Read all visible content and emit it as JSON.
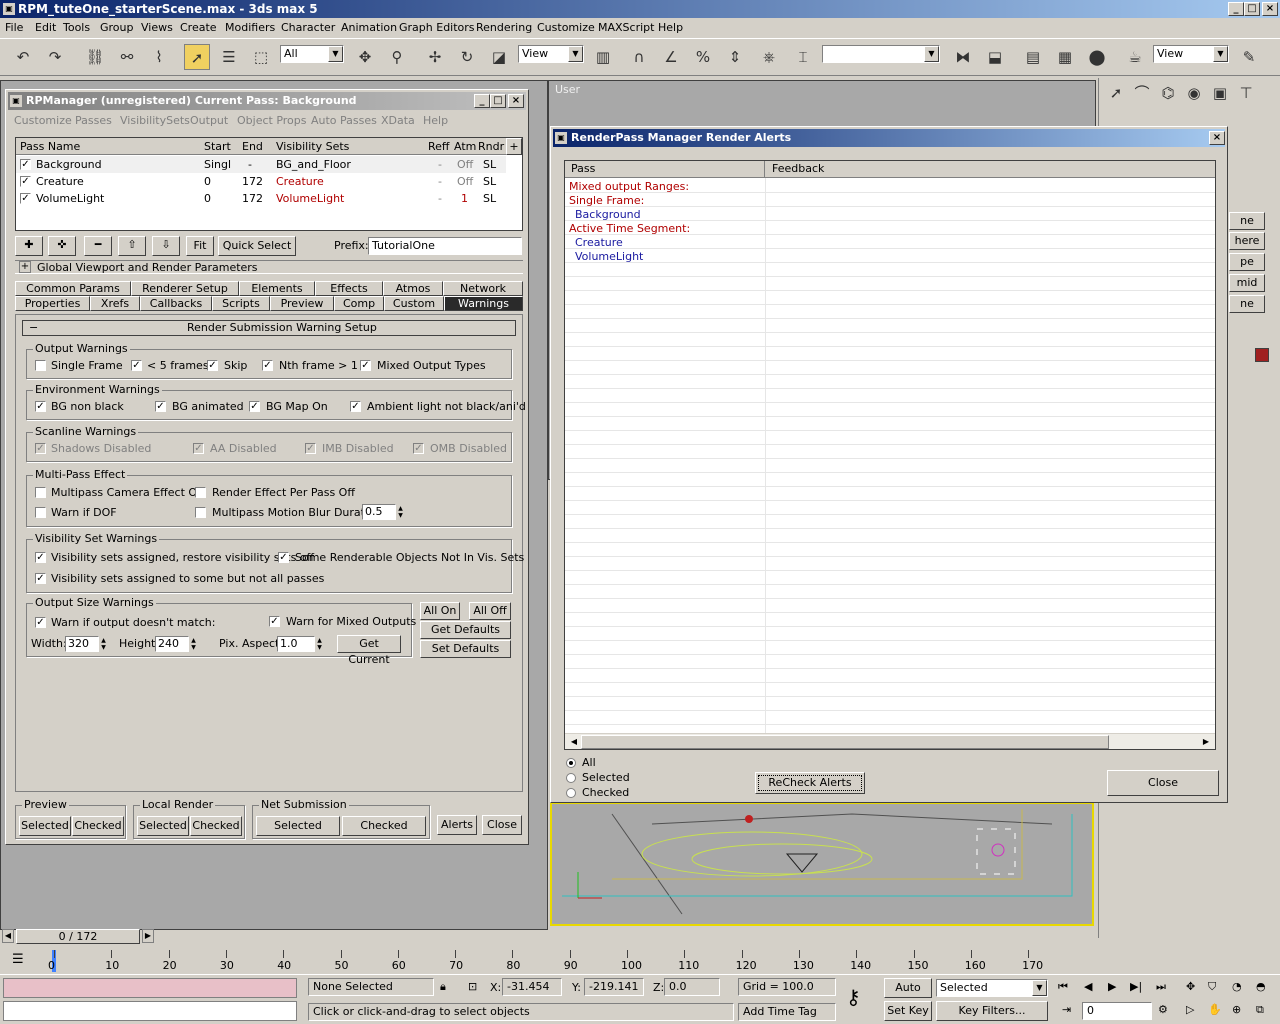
{
  "app": {
    "title": "RPM_tuteOne_starterScene.max - 3ds max 5"
  },
  "menu": [
    "File",
    "Edit",
    "Tools",
    "Group",
    "Views",
    "Create",
    "Modifiers",
    "Character",
    "Animation",
    "Graph Editors",
    "Rendering",
    "Customize",
    "MAXScript",
    "Help"
  ],
  "toolbar": {
    "selection_filter": "All",
    "ref_coord": "View",
    "named_sel": "",
    "render_type": "View"
  },
  "viewport": {
    "label": "User"
  },
  "rpm": {
    "title": "RPManager (unregistered)  Current Pass: Background",
    "menu": [
      "Customize",
      "Passes",
      "VisibilitySets",
      "Output",
      "Object Props",
      "Auto Passes",
      "XData",
      "Help"
    ],
    "columns": [
      "Pass Name",
      "Start",
      "End",
      "Visibility Sets",
      "Reff",
      "Atm",
      "Rndr"
    ],
    "add_col_btn": "+",
    "rows": [
      {
        "name": "Background",
        "start": "Singl",
        "end": "-",
        "vis": "BG_and_Floor",
        "reff": "-",
        "atm": "Off",
        "rndr": "SL"
      },
      {
        "name": "Creature",
        "start": "0",
        "end": "172",
        "vis": "Creature",
        "reff": "-",
        "atm": "Off",
        "rndr": "SL"
      },
      {
        "name": "VolumeLight",
        "start": "0",
        "end": "172",
        "vis": "VolumeLight",
        "reff": "-",
        "atm": "1",
        "rndr": "SL"
      }
    ],
    "fit_label": "Fit",
    "quick_select": "Quick Select",
    "prefix_label": "Prefix:",
    "prefix_value": "TutorialOne",
    "global_params": "Global Viewport and Render Parameters",
    "tabs_row1": [
      "Common Params",
      "Renderer Setup",
      "Elements",
      "Effects",
      "Atmos",
      "Network"
    ],
    "tabs_row2": [
      "Properties",
      "Xrefs",
      "Callbacks",
      "Scripts",
      "Preview",
      "Comp",
      "Custom",
      "Warnings"
    ],
    "rollout_title": "Render Submission Warning Setup",
    "output_warnings": {
      "title": "Output Warnings",
      "items": [
        {
          "label": "Single Frame",
          "checked": false
        },
        {
          "label": "< 5 frames",
          "checked": true
        },
        {
          "label": "Skip",
          "checked": true
        },
        {
          "label": "Nth frame > 1",
          "checked": true
        },
        {
          "label": "Mixed Output Types",
          "checked": true
        }
      ]
    },
    "env_warnings": {
      "title": "Environment Warnings",
      "items": [
        {
          "label": "BG non black",
          "checked": true
        },
        {
          "label": "BG animated",
          "checked": true
        },
        {
          "label": "BG Map On",
          "checked": true
        },
        {
          "label": "Ambient light not black/ani'd",
          "checked": true
        }
      ]
    },
    "scan_warnings": {
      "title": "Scanline Warnings",
      "items": [
        {
          "label": "Shadows Disabled",
          "checked": true
        },
        {
          "label": "AA Disabled",
          "checked": true
        },
        {
          "label": "IMB Disabled",
          "checked": true
        },
        {
          "label": "OMB Disabled",
          "checked": true
        }
      ]
    },
    "multipass": {
      "title": "Multi-Pass Effect",
      "cam": "Multipass Camera Effect Off",
      "reff": "Render Effect Per Pass Off",
      "dof": "Warn if DOF",
      "blur": "Multipass Motion Blur Duration:",
      "blur_value": "0.5"
    },
    "visset": {
      "title": "Visibility Set Warnings",
      "a": "Visibility sets assigned, restore visibility sets off",
      "b": "Some Renderable Objects Not In Vis. Sets",
      "c": "Visibility sets assigned to some but not all passes"
    },
    "outsize": {
      "title": "Output Size Warnings",
      "warn_match": "Warn if output doesn't match:",
      "warn_mixed": "Warn for Mixed Outputs",
      "width_label": "Width:",
      "width": "320",
      "height_label": "Height:",
      "height": "240",
      "aspect_label": "Pix. Aspect",
      "aspect": "1.0",
      "get_current": "Get Current"
    },
    "all_on": "All On",
    "all_off": "All Off",
    "get_defaults": "Get Defaults",
    "set_defaults": "Set Defaults",
    "preview": {
      "title": "Preview",
      "selected": "Selected",
      "checked": "Checked"
    },
    "local": {
      "title": "Local Render",
      "selected": "Selected",
      "checked": "Checked"
    },
    "net": {
      "title": "Net Submission",
      "selected": "Selected",
      "checked": "Checked"
    },
    "alerts": "Alerts",
    "close": "Close"
  },
  "alerts": {
    "title": "RenderPass Manager Render Alerts",
    "columns": [
      "Pass",
      "Feedback"
    ],
    "lines": [
      {
        "text": "Mixed output Ranges:",
        "kind": "header"
      },
      {
        "text": "Single Frame:",
        "kind": "header"
      },
      {
        "text": "Background",
        "kind": "item"
      },
      {
        "text": "Active Time Segment:",
        "kind": "header"
      },
      {
        "text": "Creature",
        "kind": "item"
      },
      {
        "text": "VolumeLight",
        "kind": "item"
      }
    ],
    "radio_all": "All",
    "radio_selected": "Selected",
    "radio_checked": "Checked",
    "recheck": "ReCheck Alerts",
    "close": "Close"
  },
  "cmdpanel": {
    "frags": [
      "ne",
      "here",
      "pe",
      "mid",
      "ne"
    ]
  },
  "timeslider": {
    "label": "0 / 172",
    "ticks": [
      "0",
      "10",
      "20",
      "30",
      "40",
      "50",
      "60",
      "70",
      "80",
      "90",
      "100",
      "110",
      "120",
      "130",
      "140",
      "150",
      "160",
      "170"
    ]
  },
  "status": {
    "selection": "None Selected",
    "prompt": "Click or click-and-drag to select objects",
    "x_label": "X:",
    "x": "-31.454",
    "y_label": "Y:",
    "y": "-219.141",
    "z_label": "Z:",
    "z": "0.0",
    "grid": "Grid = 100.0",
    "add_time_tag": "Add Time Tag",
    "auto_key": "Auto Key",
    "set_key": "Set Key",
    "key_mode": "Selected",
    "key_filters": "Key Filters...",
    "frame": "0"
  },
  "colors": {
    "accent": "#0a246a",
    "viewport": "#a8a8a8",
    "red_text": "#b00000",
    "blue_text": "#1a1aa0",
    "yellow_border": "#e8d800"
  }
}
